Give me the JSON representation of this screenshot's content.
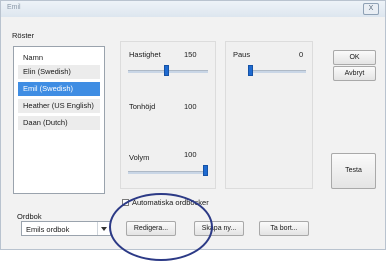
{
  "window": {
    "title": "Emil",
    "close_label": "X"
  },
  "voices": {
    "label": "Röster",
    "header": "Namn",
    "items": [
      "Elin (Swedish)",
      "Emil (Swedish)",
      "Heather (US English)",
      "Daan (Dutch)"
    ],
    "selected": "Emil (Swedish)"
  },
  "sliders": {
    "speed": {
      "label": "Hastighet",
      "value": "150",
      "level": 0.45
    },
    "pitch": {
      "label": "Tonhöjd",
      "value": "100"
    },
    "volume": {
      "label": "Volym",
      "value": "100",
      "level": 1.0
    },
    "pause": {
      "label": "Paus",
      "value": "0",
      "level": 0.0
    }
  },
  "buttons": {
    "ok": "OK",
    "cancel": "Avbryt",
    "test": "Testa",
    "edit": "Redigera...",
    "create": "Skapa ny...",
    "remove": "Ta bort..."
  },
  "auto_dictionary": {
    "label": "Automatiska ordböcker",
    "checked": false
  },
  "dictionary": {
    "label": "Ordbok",
    "value": "Emils ordbok"
  },
  "colors": {
    "selection": "#3f8de3",
    "slider_thumb": "#1f6bd1",
    "annotation_ellipse": "#2c3a86"
  }
}
